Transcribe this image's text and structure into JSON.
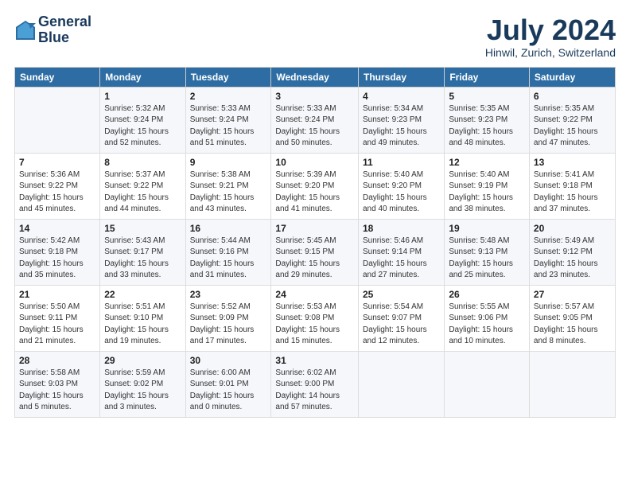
{
  "header": {
    "logo_line1": "General",
    "logo_line2": "Blue",
    "main_title": "July 2024",
    "subtitle": "Hinwil, Zurich, Switzerland"
  },
  "calendar": {
    "days_of_week": [
      "Sunday",
      "Monday",
      "Tuesday",
      "Wednesday",
      "Thursday",
      "Friday",
      "Saturday"
    ],
    "weeks": [
      [
        {
          "num": "",
          "detail": ""
        },
        {
          "num": "1",
          "detail": "Sunrise: 5:32 AM\nSunset: 9:24 PM\nDaylight: 15 hours\nand 52 minutes."
        },
        {
          "num": "2",
          "detail": "Sunrise: 5:33 AM\nSunset: 9:24 PM\nDaylight: 15 hours\nand 51 minutes."
        },
        {
          "num": "3",
          "detail": "Sunrise: 5:33 AM\nSunset: 9:24 PM\nDaylight: 15 hours\nand 50 minutes."
        },
        {
          "num": "4",
          "detail": "Sunrise: 5:34 AM\nSunset: 9:23 PM\nDaylight: 15 hours\nand 49 minutes."
        },
        {
          "num": "5",
          "detail": "Sunrise: 5:35 AM\nSunset: 9:23 PM\nDaylight: 15 hours\nand 48 minutes."
        },
        {
          "num": "6",
          "detail": "Sunrise: 5:35 AM\nSunset: 9:22 PM\nDaylight: 15 hours\nand 47 minutes."
        }
      ],
      [
        {
          "num": "7",
          "detail": "Sunrise: 5:36 AM\nSunset: 9:22 PM\nDaylight: 15 hours\nand 45 minutes."
        },
        {
          "num": "8",
          "detail": "Sunrise: 5:37 AM\nSunset: 9:22 PM\nDaylight: 15 hours\nand 44 minutes."
        },
        {
          "num": "9",
          "detail": "Sunrise: 5:38 AM\nSunset: 9:21 PM\nDaylight: 15 hours\nand 43 minutes."
        },
        {
          "num": "10",
          "detail": "Sunrise: 5:39 AM\nSunset: 9:20 PM\nDaylight: 15 hours\nand 41 minutes."
        },
        {
          "num": "11",
          "detail": "Sunrise: 5:40 AM\nSunset: 9:20 PM\nDaylight: 15 hours\nand 40 minutes."
        },
        {
          "num": "12",
          "detail": "Sunrise: 5:40 AM\nSunset: 9:19 PM\nDaylight: 15 hours\nand 38 minutes."
        },
        {
          "num": "13",
          "detail": "Sunrise: 5:41 AM\nSunset: 9:18 PM\nDaylight: 15 hours\nand 37 minutes."
        }
      ],
      [
        {
          "num": "14",
          "detail": "Sunrise: 5:42 AM\nSunset: 9:18 PM\nDaylight: 15 hours\nand 35 minutes."
        },
        {
          "num": "15",
          "detail": "Sunrise: 5:43 AM\nSunset: 9:17 PM\nDaylight: 15 hours\nand 33 minutes."
        },
        {
          "num": "16",
          "detail": "Sunrise: 5:44 AM\nSunset: 9:16 PM\nDaylight: 15 hours\nand 31 minutes."
        },
        {
          "num": "17",
          "detail": "Sunrise: 5:45 AM\nSunset: 9:15 PM\nDaylight: 15 hours\nand 29 minutes."
        },
        {
          "num": "18",
          "detail": "Sunrise: 5:46 AM\nSunset: 9:14 PM\nDaylight: 15 hours\nand 27 minutes."
        },
        {
          "num": "19",
          "detail": "Sunrise: 5:48 AM\nSunset: 9:13 PM\nDaylight: 15 hours\nand 25 minutes."
        },
        {
          "num": "20",
          "detail": "Sunrise: 5:49 AM\nSunset: 9:12 PM\nDaylight: 15 hours\nand 23 minutes."
        }
      ],
      [
        {
          "num": "21",
          "detail": "Sunrise: 5:50 AM\nSunset: 9:11 PM\nDaylight: 15 hours\nand 21 minutes."
        },
        {
          "num": "22",
          "detail": "Sunrise: 5:51 AM\nSunset: 9:10 PM\nDaylight: 15 hours\nand 19 minutes."
        },
        {
          "num": "23",
          "detail": "Sunrise: 5:52 AM\nSunset: 9:09 PM\nDaylight: 15 hours\nand 17 minutes."
        },
        {
          "num": "24",
          "detail": "Sunrise: 5:53 AM\nSunset: 9:08 PM\nDaylight: 15 hours\nand 15 minutes."
        },
        {
          "num": "25",
          "detail": "Sunrise: 5:54 AM\nSunset: 9:07 PM\nDaylight: 15 hours\nand 12 minutes."
        },
        {
          "num": "26",
          "detail": "Sunrise: 5:55 AM\nSunset: 9:06 PM\nDaylight: 15 hours\nand 10 minutes."
        },
        {
          "num": "27",
          "detail": "Sunrise: 5:57 AM\nSunset: 9:05 PM\nDaylight: 15 hours\nand 8 minutes."
        }
      ],
      [
        {
          "num": "28",
          "detail": "Sunrise: 5:58 AM\nSunset: 9:03 PM\nDaylight: 15 hours\nand 5 minutes."
        },
        {
          "num": "29",
          "detail": "Sunrise: 5:59 AM\nSunset: 9:02 PM\nDaylight: 15 hours\nand 3 minutes."
        },
        {
          "num": "30",
          "detail": "Sunrise: 6:00 AM\nSunset: 9:01 PM\nDaylight: 15 hours\nand 0 minutes."
        },
        {
          "num": "31",
          "detail": "Sunrise: 6:02 AM\nSunset: 9:00 PM\nDaylight: 14 hours\nand 57 minutes."
        },
        {
          "num": "",
          "detail": ""
        },
        {
          "num": "",
          "detail": ""
        },
        {
          "num": "",
          "detail": ""
        }
      ]
    ]
  }
}
